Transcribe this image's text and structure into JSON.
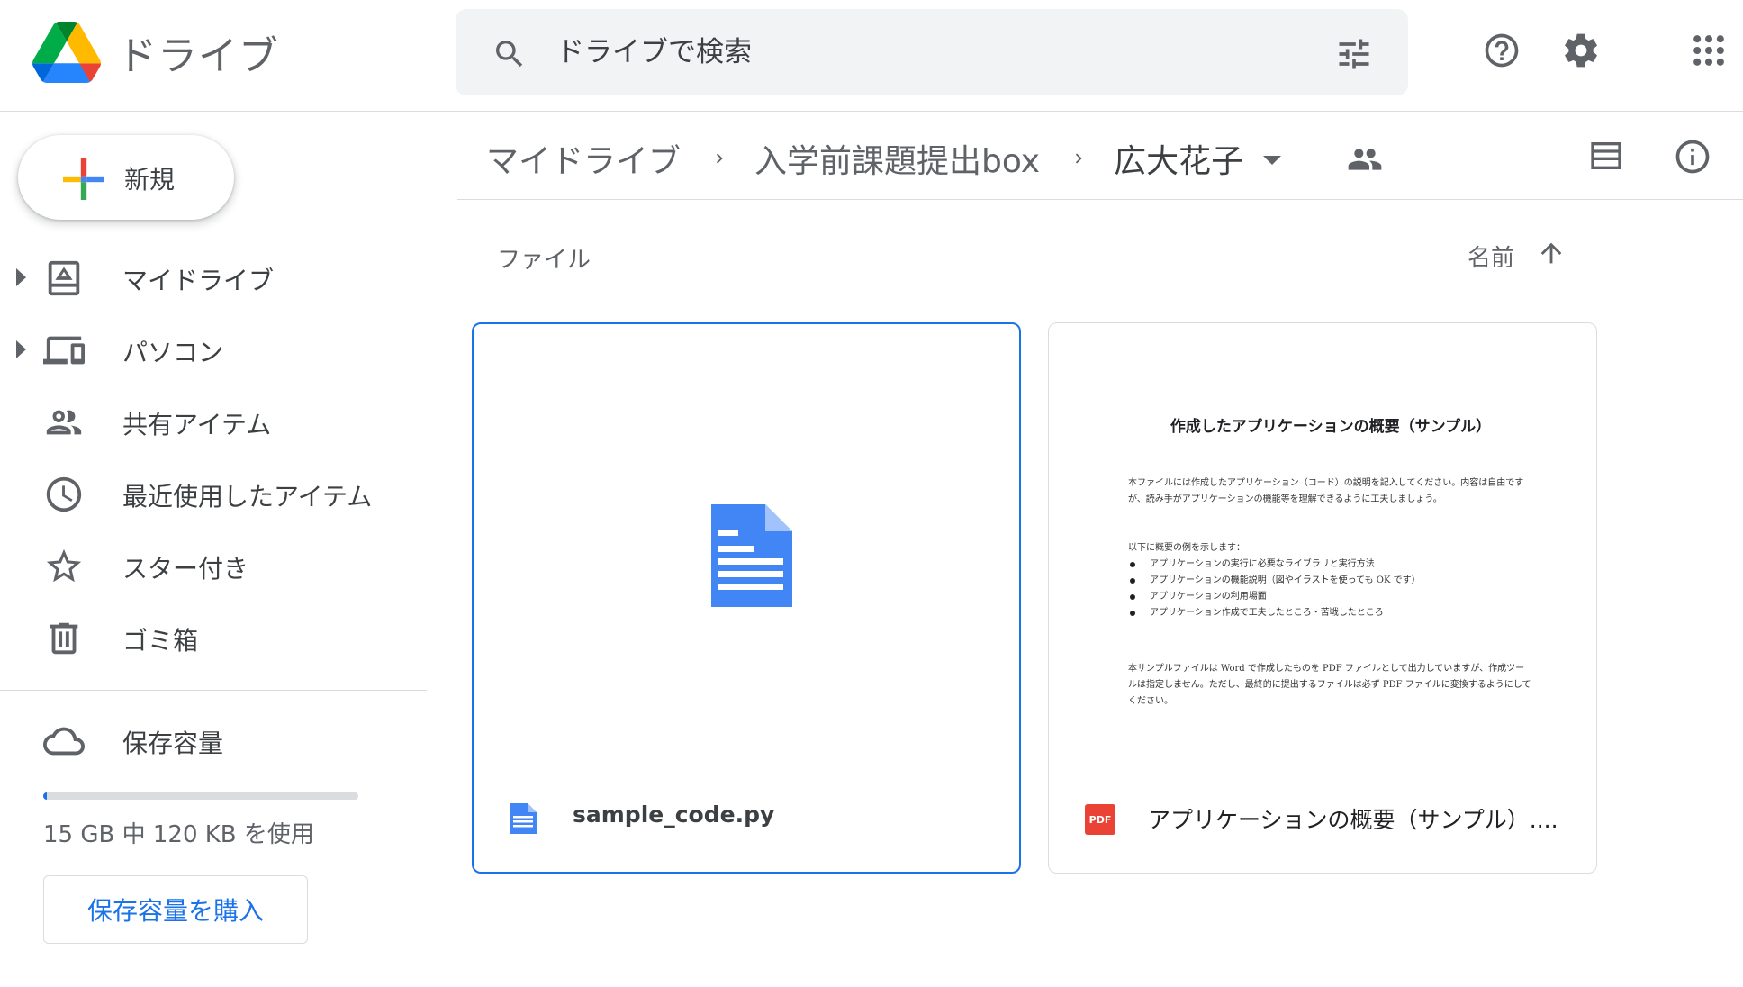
{
  "app": {
    "title": "ドライブ"
  },
  "search": {
    "placeholder": "ドライブで検索"
  },
  "sidebar": {
    "new_label": "新規",
    "items": [
      {
        "label": "マイドライブ",
        "icon": "my-drive-icon",
        "expandable": true
      },
      {
        "label": "パソコン",
        "icon": "computers-icon",
        "expandable": true
      },
      {
        "label": "共有アイテム",
        "icon": "shared-icon",
        "expandable": false
      },
      {
        "label": "最近使用したアイテム",
        "icon": "clock-icon",
        "expandable": false
      },
      {
        "label": "スター付き",
        "icon": "star-icon",
        "expandable": false
      },
      {
        "label": "ゴミ箱",
        "icon": "trash-icon",
        "expandable": false
      }
    ],
    "storage_label": "保存容量",
    "storage_text": "15 GB 中 120 KB を使用",
    "storage_used_fraction": 0.01,
    "buy_label": "保存容量を購入"
  },
  "breadcrumb": [
    "マイドライブ",
    "入学前課題提出box",
    "広大花子"
  ],
  "section_label": "ファイル",
  "sort": {
    "label": "名前",
    "direction": "ascending"
  },
  "files": [
    {
      "name": "sample_code.py",
      "type": "doc",
      "selected": true
    },
    {
      "name": "アプリケーションの概要（サンプル）....",
      "type": "pdf",
      "badge": "PDF",
      "selected": false,
      "preview": {
        "title": "作成したアプリケーションの概要（サンプル）",
        "para1": "本ファイルには作成したアプリケーション（コード）の説明を記入してください。内容は自由ですが、読み手がアプリケーションの機能等を理解できるように工夫しましょう。",
        "list_lead": "以下に概要の例を示します：",
        "list": [
          "アプリケーションの実行に必要なライブラリと実行方法",
          "アプリケーションの機能説明（図やイラストを使っても OK です）",
          "アプリケーションの利用場面",
          "アプリケーション作成で工夫したところ・苦戦したところ"
        ],
        "para2": "本サンプルファイルは Word で作成したものを PDF ファイルとして出力していますが、作成ツールは指定しません。ただし、最終的に提出するファイルは必ず PDF ファイルに変換するようにしてください。"
      }
    }
  ],
  "colors": {
    "accent": "#1a73e8",
    "doc_blue": "#4285f4",
    "pdf_red": "#ea4335"
  }
}
